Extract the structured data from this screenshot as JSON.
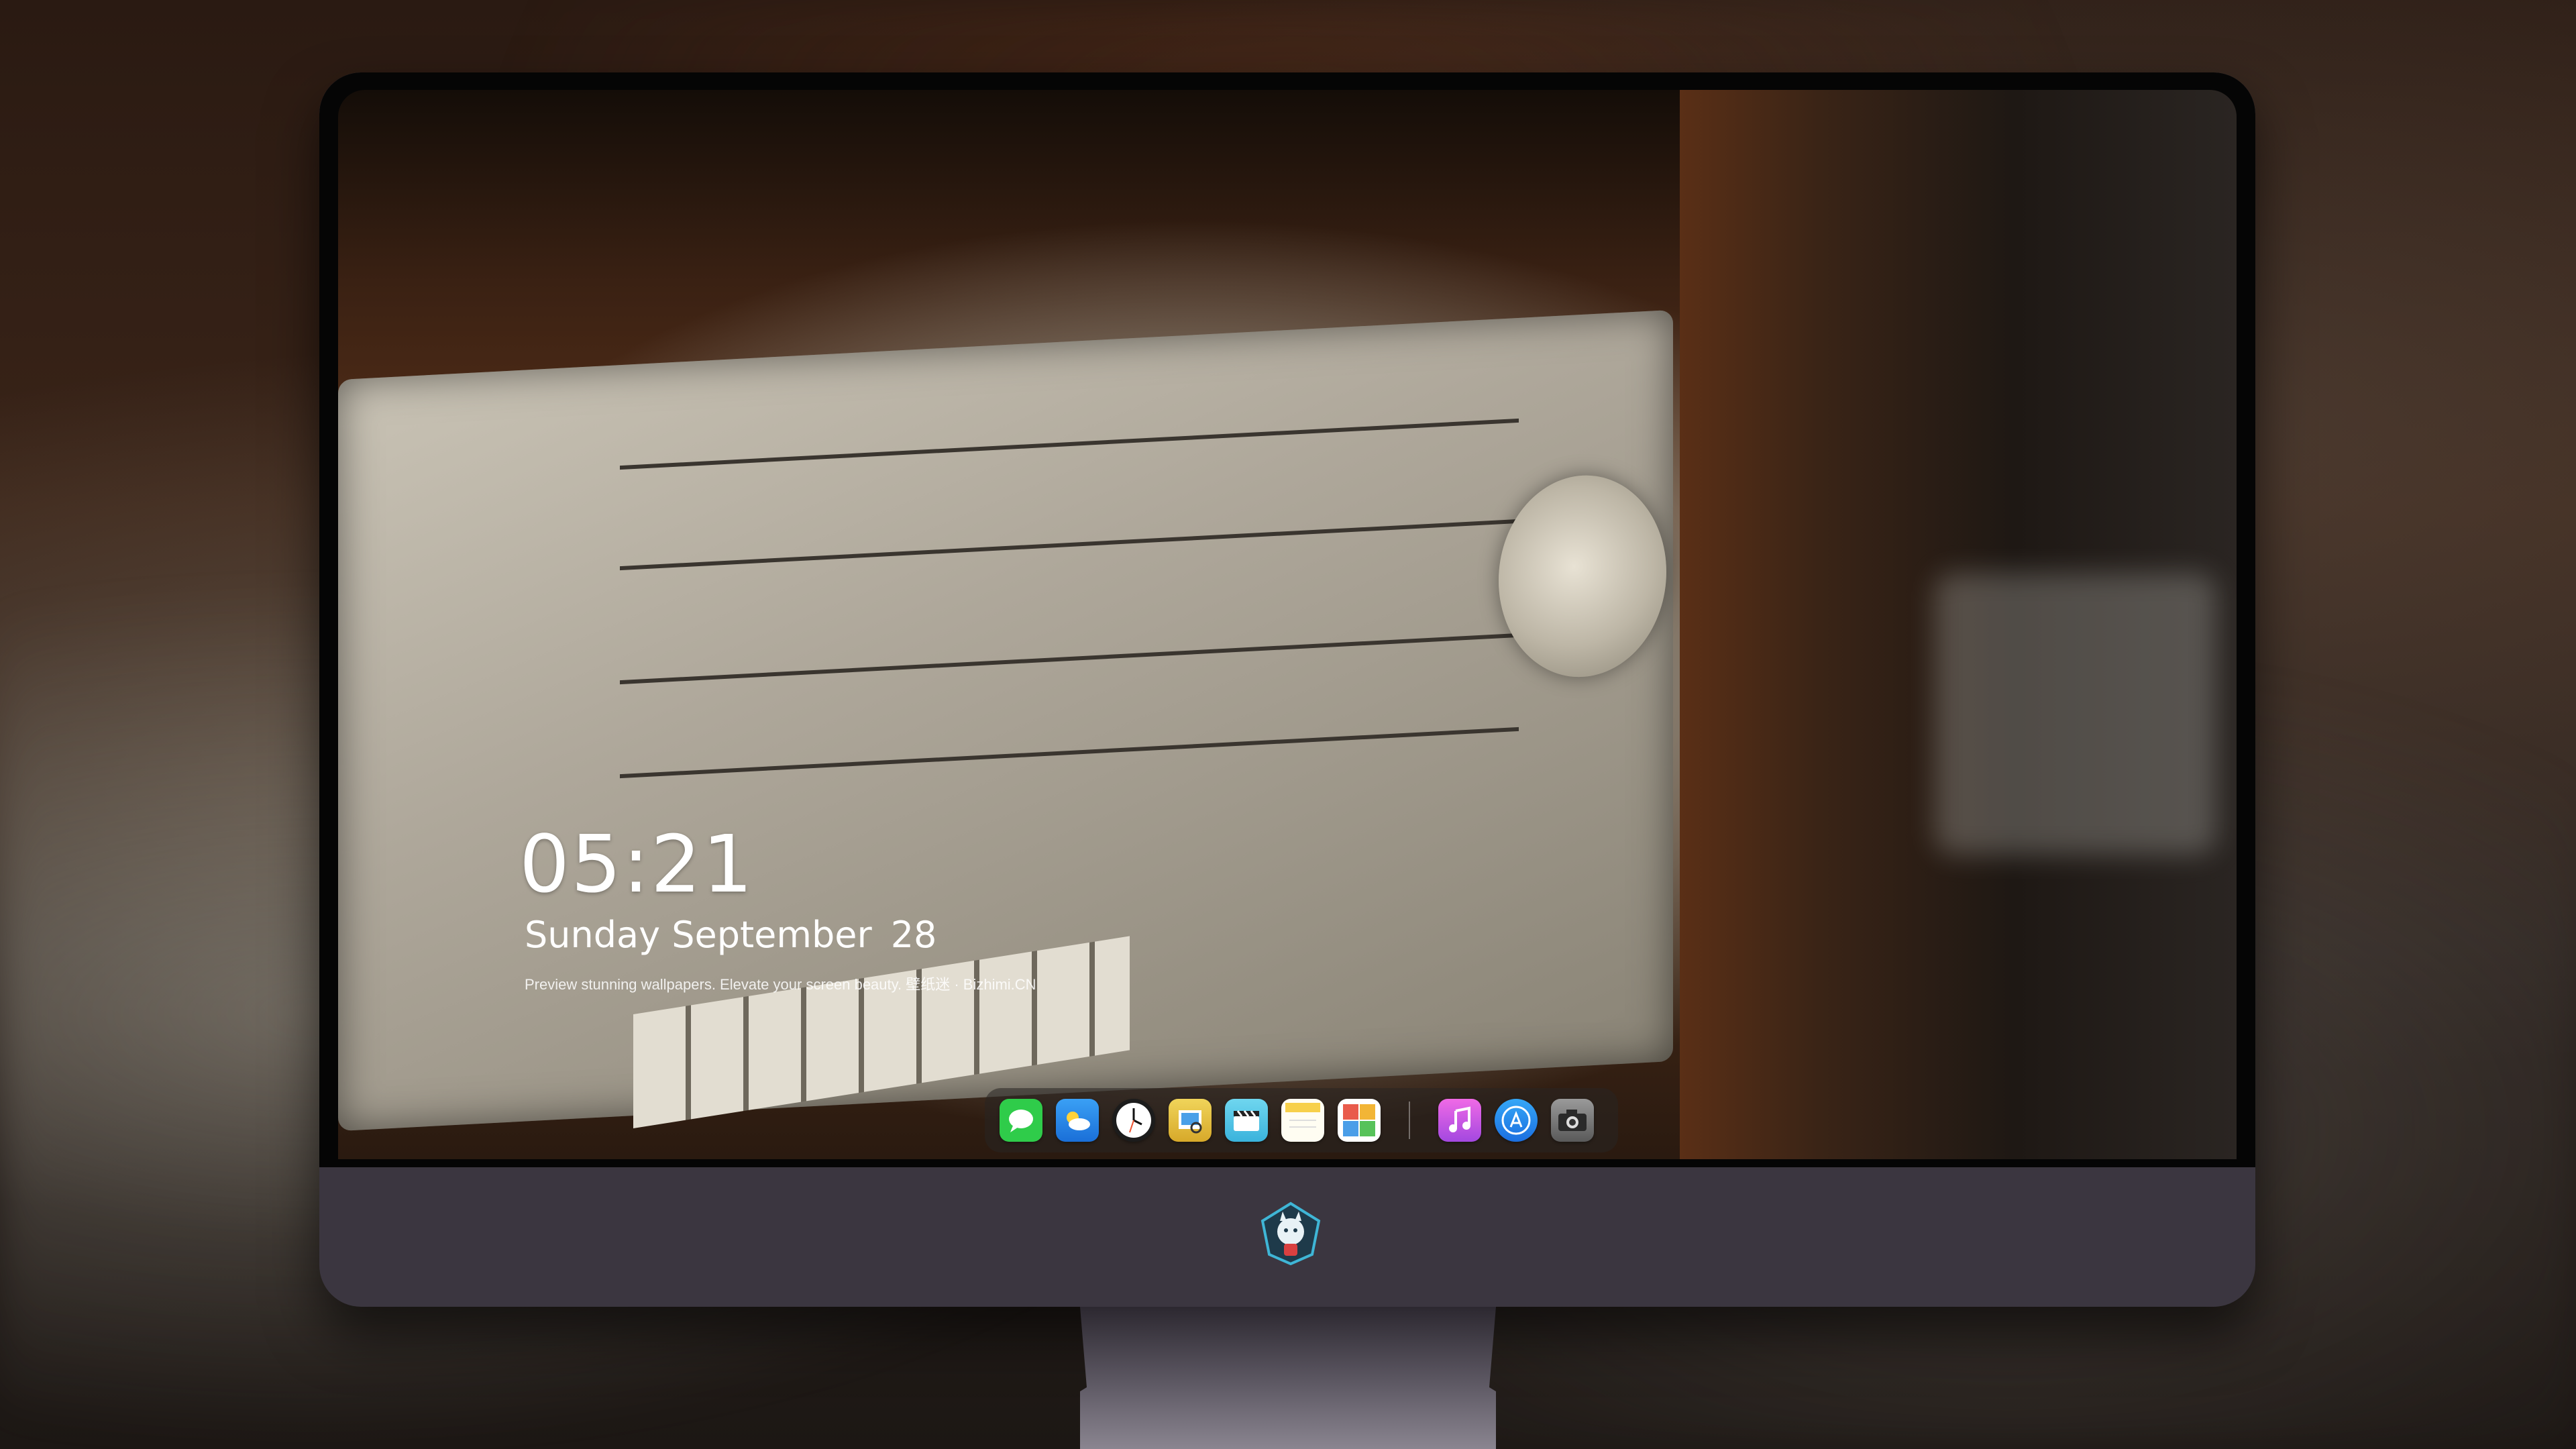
{
  "lock_screen": {
    "time": "05:21",
    "weekday_month": "Sunday September",
    "day": "28",
    "tagline": "Preview stunning wallpapers. Elevate your screen beauty. 壁纸迷 · Bizhimi.CN"
  },
  "dock": {
    "apps": [
      {
        "name": "messages-icon",
        "color": "#2fcc4a"
      },
      {
        "name": "weather-icon",
        "color": "#2f86e8"
      },
      {
        "name": "clock-icon",
        "color": "#1c1c1c"
      },
      {
        "name": "preview-icon",
        "color": "#e9c23a"
      },
      {
        "name": "clips-icon",
        "color": "#58c8e8"
      },
      {
        "name": "notes-icon",
        "color": "#f7d04a"
      },
      {
        "name": "photo-booth-icon",
        "color": "#e95b4c"
      },
      {
        "name": "itunes-icon",
        "color": "#d84fd6"
      },
      {
        "name": "app-store-icon",
        "color": "#2a8cf0"
      },
      {
        "name": "camera-icon",
        "color": "#7a7a7a"
      }
    ]
  },
  "colors": {
    "monitor_body": "#3b3640",
    "bezel": "#050505",
    "text": "#ffffff"
  }
}
